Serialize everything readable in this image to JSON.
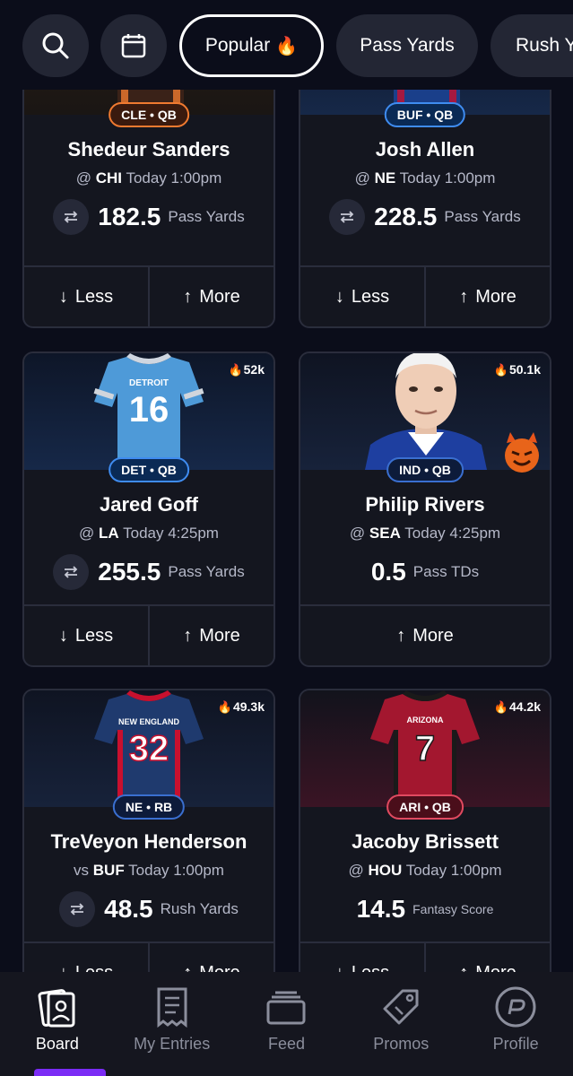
{
  "filters": {
    "search_icon": "search-icon",
    "calendar_icon": "calendar-icon",
    "pills": [
      {
        "label": "Popular",
        "emoji": "🔥",
        "active": true
      },
      {
        "label": "Pass Yards",
        "active": false
      },
      {
        "label": "Rush Y",
        "active": false
      }
    ]
  },
  "cards": [
    {
      "player": "Shedeur Sanders",
      "tag": "CLE • QB",
      "prefix": "@",
      "opponent": "CHI",
      "time": "Today 1:00pm",
      "line": "182.5",
      "stat": "Pass Yards",
      "less": "Less",
      "more": "More",
      "trend": ""
    },
    {
      "player": "Josh Allen",
      "tag": "BUF • QB",
      "prefix": "@",
      "opponent": "NE",
      "time": "Today 1:00pm",
      "line": "228.5",
      "stat": "Pass Yards",
      "less": "Less",
      "more": "More",
      "trend": ""
    },
    {
      "player": "Jared Goff",
      "tag": "DET • QB",
      "prefix": "@",
      "opponent": "LA",
      "time": "Today 4:25pm",
      "line": "255.5",
      "stat": "Pass Yards",
      "less": "Less",
      "more": "More",
      "trend": "52k",
      "jersey_team": "DETROIT",
      "jersey_number": "16"
    },
    {
      "player": "Philip Rivers",
      "tag": "IND • QB",
      "prefix": "@",
      "opponent": "SEA",
      "time": "Today 4:25pm",
      "line": "0.5",
      "stat": "Pass TDs",
      "more": "More",
      "trend": "50.1k"
    },
    {
      "player": "TreVeyon Henderson",
      "tag": "NE • RB",
      "prefix": "vs",
      "opponent": "BUF",
      "time": "Today 1:00pm",
      "line": "48.5",
      "stat": "Rush Yards",
      "less": "Less",
      "more": "More",
      "trend": "49.3k",
      "jersey_team": "NEW ENGLAND",
      "jersey_number": "32"
    },
    {
      "player": "Jacoby Brissett",
      "tag": "ARI • QB",
      "prefix": "@",
      "opponent": "HOU",
      "time": "Today 1:00pm",
      "line": "14.5",
      "stat": "Fantasy Score",
      "less": "Less",
      "more": "More",
      "trend": "44.2k",
      "jersey_team": "ARIZONA",
      "jersey_number": "7"
    }
  ],
  "nav": [
    {
      "label": "Board",
      "icon": "board-icon",
      "active": true
    },
    {
      "label": "My Entries",
      "icon": "entries-icon",
      "active": false
    },
    {
      "label": "Feed",
      "icon": "feed-icon",
      "active": false
    },
    {
      "label": "Promos",
      "icon": "promos-icon",
      "active": false
    },
    {
      "label": "Profile",
      "icon": "profile-icon",
      "active": false
    }
  ],
  "colors": {
    "accent": "#7b2cf5",
    "background": "#0b0d1a",
    "card": "#14161f"
  }
}
